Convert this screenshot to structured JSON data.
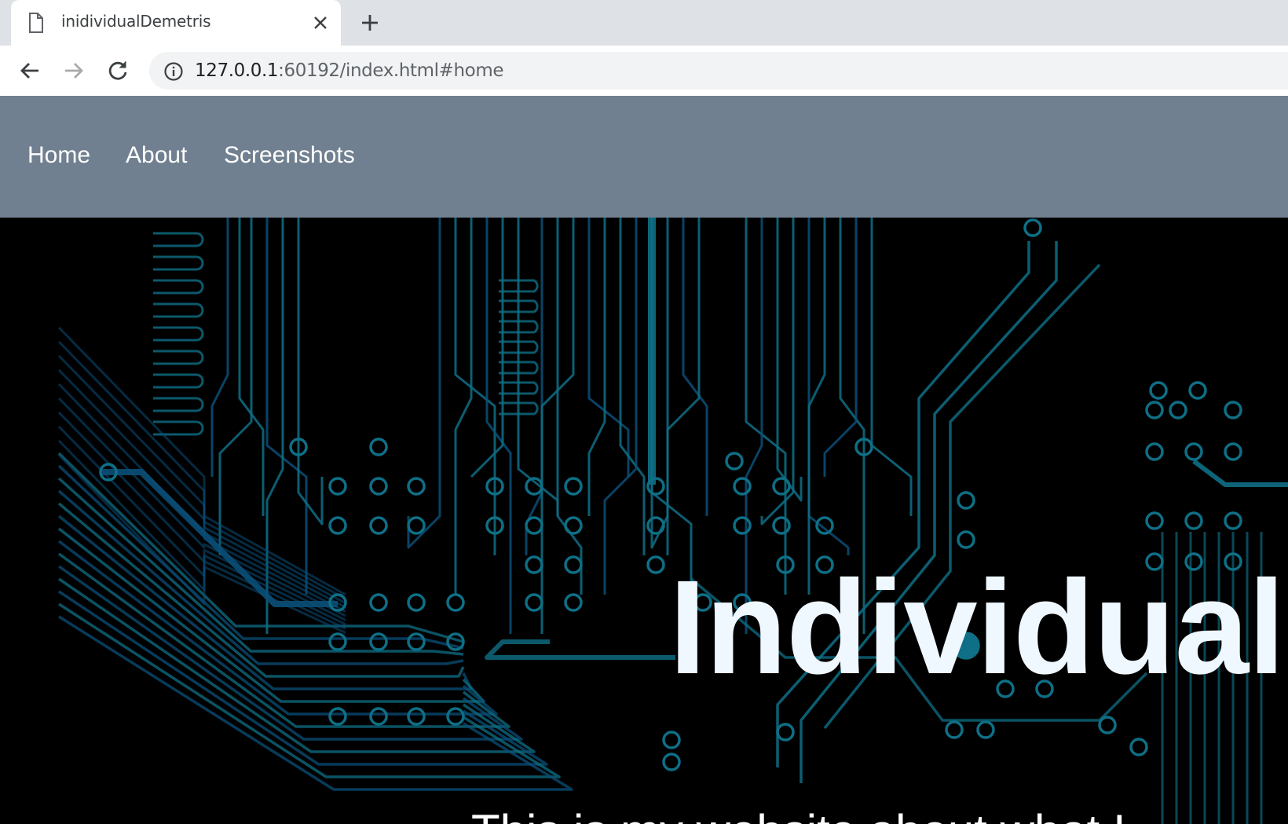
{
  "browser": {
    "tab_title": "inidividualDemetris",
    "url_host": "127.0.0.1",
    "url_rest": ":60192/index.html#home"
  },
  "nav": {
    "items": [
      {
        "label": "Home"
      },
      {
        "label": "About"
      },
      {
        "label": "Screenshots"
      }
    ]
  },
  "hero": {
    "title": "Individual",
    "subtitle": "This is my website about what I"
  },
  "colors": {
    "nav_background": "#708090",
    "hero_background": "#000000",
    "title_color": "#f0f8ff",
    "circuit_trace": "#0e6f86",
    "circuit_trace_blue": "#0a4f78"
  }
}
